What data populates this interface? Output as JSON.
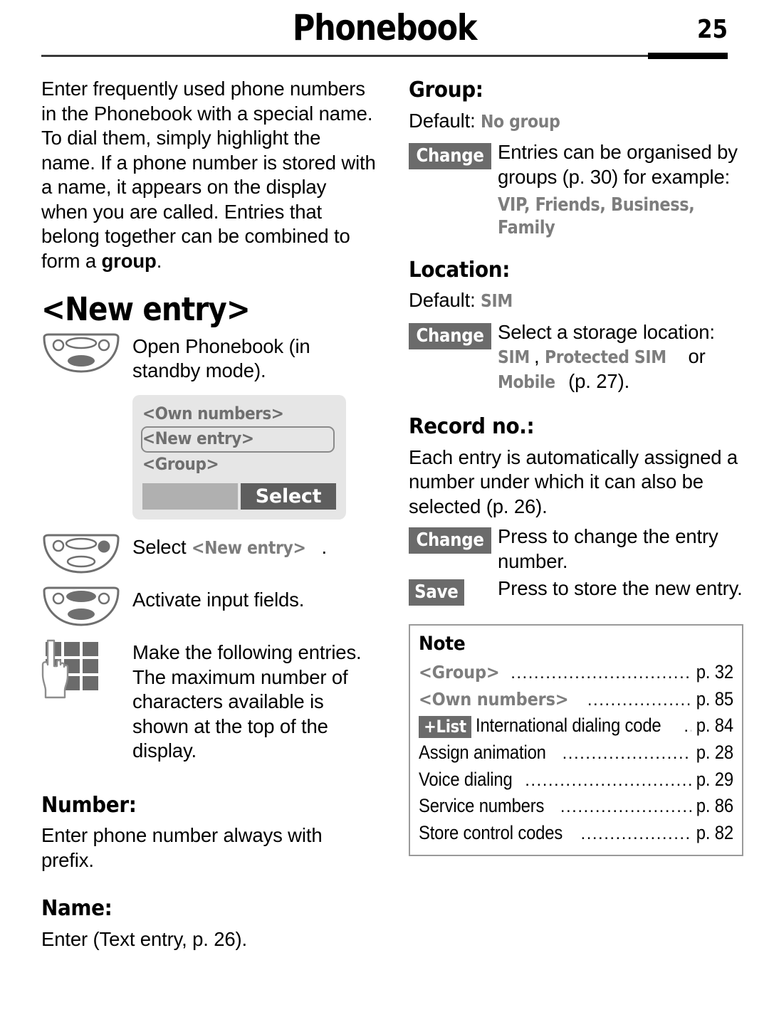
{
  "header": {
    "title": "Phonebook",
    "page_number": "25"
  },
  "left_column": {
    "intro": {
      "text_before_bold": "Enter frequently used phone numbers in the Phonebook with a special name. To dial them, simply highlight the name. If a phone number is stored with a name, it appears on the display when you are called. Entries that belong together can be combined to form a ",
      "bold_word": "group",
      "text_after_bold": "."
    },
    "new_entry_heading": "<New entry>",
    "steps": [
      {
        "icon": "navigation-key-icon",
        "text": "Open Phonebook (in standby mode)."
      }
    ],
    "phone_display": {
      "items": [
        {
          "label": "<Own numbers>",
          "selected": false
        },
        {
          "label": "<New entry>",
          "selected": true
        },
        {
          "label": "<Group>",
          "selected": false
        }
      ],
      "softkey_left": "",
      "softkey_right": "Select"
    },
    "steps2": [
      {
        "icon": "navigation-key-right-icon",
        "text_before_ui": "Select ",
        "ui_text": "<New entry>",
        "text_after_ui": "."
      },
      {
        "icon": "navigation-key-press-icon",
        "text_before_ui": "Activate input fields.",
        "ui_text": "",
        "text_after_ui": ""
      },
      {
        "icon": "keypad-icon",
        "text_before_ui": "Make the following entries. The maximum number of characters available is shown at the top of the display.",
        "ui_text": "",
        "text_after_ui": ""
      }
    ],
    "number_section": {
      "heading": "Number:",
      "body": "Enter phone number always with prefix."
    },
    "name_section": {
      "heading": "Name:",
      "body": "Enter (Text entry, p. 26)."
    }
  },
  "right_column": {
    "group_section": {
      "heading": "Group:",
      "default_label": "Default: ",
      "default_value": "No group",
      "change_key": "Change",
      "change_text": "Entries can be organised by groups (p. 30) for example:",
      "examples": "VIP, Friends, Business, Family"
    },
    "location_section": {
      "heading": "Location:",
      "default_label": "Default: ",
      "default_value": "SIM",
      "change_key": "Change",
      "change_text": "Select a storage location:",
      "opt1": "SIM",
      "sep1": ", ",
      "opt2": "Protected SIM",
      "sep2": " or ",
      "opt3": "Mobile",
      "tail": " (p. 27)."
    },
    "record_section": {
      "heading": "Record no.:",
      "body": "Each entry is automatically assigned a number under which it can also be selected (p. 26).",
      "change_key": "Change",
      "change_text": "Press to change the entry number.",
      "save_key": "Save",
      "save_text": "Press to store the new entry."
    },
    "note_box": {
      "title": "Note",
      "rows": [
        {
          "key": "",
          "label": "<Group>",
          "style": "ui",
          "page": "p. 32"
        },
        {
          "key": "",
          "label": "<Own numbers>",
          "style": "ui",
          "page": "p. 85"
        },
        {
          "key": "+List",
          "label": "International dialing code",
          "style": "plain",
          "page": "p. 84"
        },
        {
          "key": "",
          "label": "Assign animation",
          "style": "plain",
          "page": "p. 28"
        },
        {
          "key": "",
          "label": "Voice dialing",
          "style": "plain",
          "page": "p. 29"
        },
        {
          "key": "",
          "label": "Service numbers",
          "style": "plain",
          "page": "p. 86"
        },
        {
          "key": "",
          "label": "Store control codes",
          "style": "plain",
          "page": "p. 82"
        }
      ]
    }
  },
  "colors": {
    "ui_gray": "#7d7d7d",
    "softkey_bg": "#6b6b6b",
    "display_bg": "#e6e6e6",
    "display_text": "#6f6f6f",
    "select_btn": "#5e5e5e"
  }
}
